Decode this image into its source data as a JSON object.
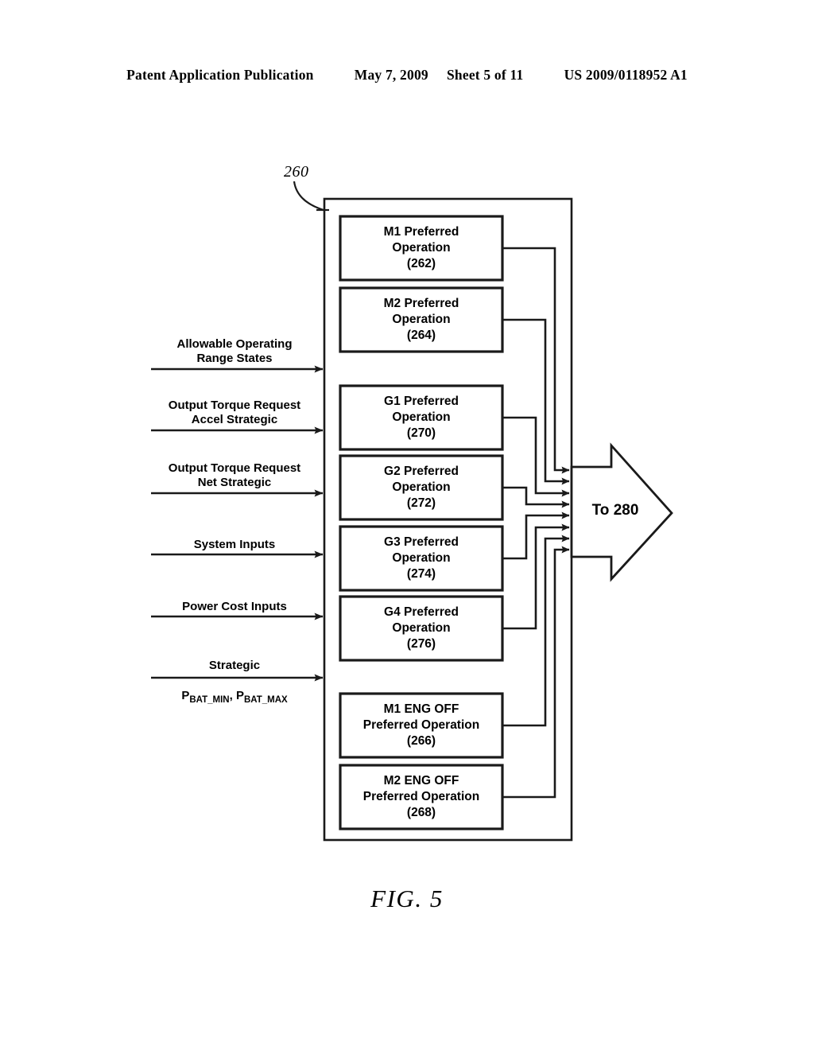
{
  "header": {
    "publication": "Patent Application Publication",
    "date": "May 7, 2009",
    "sheet": "Sheet 5 of 11",
    "patent_number": "US 2009/0118952 A1"
  },
  "figure": {
    "caption": "FIG. 5",
    "container_ref": "260"
  },
  "inputs": [
    {
      "name": "allowable-operating-range-states",
      "label": "Allowable Operating\nRange States"
    },
    {
      "name": "output-torque-request-accel-strategic",
      "label": "Output Torque Request\nAccel Strategic"
    },
    {
      "name": "output-torque-request-net-strategic",
      "label": "Output Torque Request\nNet Strategic"
    },
    {
      "name": "system-inputs",
      "label": "System Inputs"
    },
    {
      "name": "power-cost-inputs",
      "label": "Power Cost Inputs"
    },
    {
      "name": "strategic-pbat",
      "label": "Strategic",
      "line2_prefix": "P",
      "line2_sub1": "BAT_MIN",
      "line2_mid": ", ",
      "line2_prefix2": "P",
      "line2_sub2": "BAT_MAX"
    }
  ],
  "blocks": [
    {
      "name": "m1-preferred-operation",
      "label": "M1 Preferred\nOperation\n(262)",
      "ref": "262"
    },
    {
      "name": "m2-preferred-operation",
      "label": "M2 Preferred\nOperation\n(264)",
      "ref": "264"
    },
    {
      "name": "g1-preferred-operation",
      "label": "G1 Preferred\nOperation\n(270)",
      "ref": "270"
    },
    {
      "name": "g2-preferred-operation",
      "label": "G2 Preferred\nOperation\n(272)",
      "ref": "272"
    },
    {
      "name": "g3-preferred-operation",
      "label": "G3 Preferred\nOperation\n(274)",
      "ref": "274"
    },
    {
      "name": "g4-preferred-operation",
      "label": "G4 Preferred\nOperation\n(276)",
      "ref": "276"
    },
    {
      "name": "m1-eng-off-preferred-operation",
      "label": "M1 ENG OFF\nPreferred Operation\n(266)",
      "ref": "266"
    },
    {
      "name": "m2-eng-off-preferred-operation",
      "label": "M2 ENG OFF\nPreferred Operation\n(268)",
      "ref": "268"
    }
  ],
  "output": {
    "label": "To 280"
  },
  "colors": {
    "line": "#1a1a1a",
    "background": "#ffffff",
    "text": "#000000"
  }
}
